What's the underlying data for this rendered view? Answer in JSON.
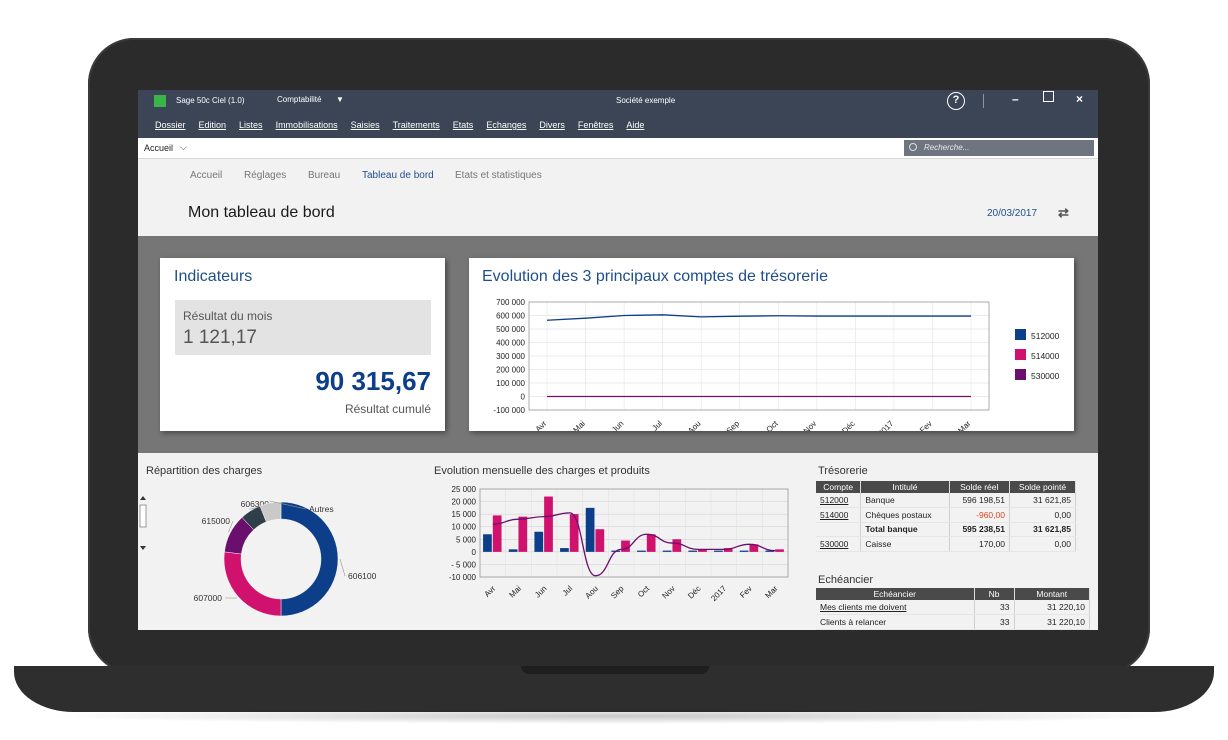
{
  "window": {
    "app_name": "Sage 50c Ciel (1.0)",
    "module": "Comptabilité",
    "company": "Société exemple",
    "help_glyph": "?",
    "minimize_glyph": "–",
    "close_glyph": "×"
  },
  "menu": [
    "Dossier",
    "Edition",
    "Listes",
    "Immobilisations",
    "Saisies",
    "Traitements",
    "Etats",
    "Echanges",
    "Divers",
    "Fenêtres",
    "Aide"
  ],
  "address": {
    "location": "Accueil",
    "search_placeholder": "Recherche..."
  },
  "tabs": [
    "Accueil",
    "Réglages",
    "Bureau",
    "Tableau de bord",
    "Etats et statistiques"
  ],
  "active_tab": "Tableau de bord",
  "page": {
    "title": "Mon tableau de bord",
    "date": "20/03/2017"
  },
  "indicateurs": {
    "title": "Indicateurs",
    "month_label": "Résultat du mois",
    "month_value": "1 121,17",
    "cumul_value": "90 315,67",
    "cumul_label": "Résultat cumulé"
  },
  "colors": {
    "accent": "#1f4e8c",
    "series_512000": "#0d3e8a",
    "series_514000": "#d0116e",
    "series_530000": "#6a0f6e",
    "negative": "#e0451b"
  },
  "icons": {
    "search": "search-icon",
    "refresh": "refresh-icon",
    "help": "help-icon",
    "dropdown": "chevron-down-icon"
  },
  "chart_data": [
    {
      "type": "line",
      "title": "Evolution des 3 principaux comptes de trésorerie",
      "categories": [
        "Avr",
        "Mai",
        "Jun",
        "Jul",
        "Aou",
        "Sep",
        "Oct",
        "Nov",
        "Déc",
        "2017",
        "Fev",
        "Mar"
      ],
      "ylim": [
        -100000,
        700000
      ],
      "yticks": [
        "700 000",
        "600 000",
        "500 000",
        "400 000",
        "300 000",
        "200 000",
        "100 000",
        "0",
        "-100 000"
      ],
      "grid": true,
      "legend": "right",
      "series": [
        {
          "name": "512000",
          "values": [
            565000,
            580000,
            600000,
            605000,
            590000,
            595000,
            598000,
            596000,
            596000,
            596000,
            596000,
            596000
          ]
        },
        {
          "name": "514000",
          "values": [
            -1000,
            -1000,
            -1000,
            -1000,
            -1000,
            -1000,
            -1000,
            -1000,
            -1000,
            -1000,
            -1000,
            -1000
          ]
        },
        {
          "name": "530000",
          "values": [
            170,
            170,
            170,
            170,
            170,
            170,
            170,
            170,
            170,
            170,
            170,
            170
          ]
        }
      ]
    },
    {
      "type": "pie",
      "title": "Répartition des charges",
      "labels": [
        "606100",
        "607000",
        "615000",
        "606300",
        "Autres"
      ],
      "values": [
        50,
        27,
        11,
        6,
        6
      ]
    },
    {
      "type": "bar",
      "title": "Evolution mensuelle des charges et produits",
      "categories": [
        "Avr",
        "Mai",
        "Jun",
        "Jul",
        "Aou",
        "Sep",
        "Oct",
        "Nov",
        "Déc",
        "2017",
        "Fev",
        "Mar"
      ],
      "ylim": [
        -10000,
        25000
      ],
      "yticks": [
        "25 000",
        "20 000",
        "15 000",
        "10 000",
        "5 000",
        "0",
        "- 5 000",
        "-10 000"
      ],
      "grid": true,
      "series": [
        {
          "name": "",
          "values": [
            7000,
            1000,
            8000,
            1500,
            17500,
            500,
            500,
            500,
            500,
            500,
            500,
            500
          ]
        },
        {
          "name": "",
          "values": [
            14500,
            14000,
            22000,
            15000,
            9000,
            4500,
            7000,
            5000,
            1000,
            1500,
            3000,
            1000
          ]
        },
        {
          "name": "",
          "values": [
            11000,
            13000,
            14000,
            15500,
            -9500,
            1000,
            7000,
            3500,
            1000,
            1000,
            3000,
            500
          ]
        }
      ]
    }
  ],
  "tresorerie": {
    "title": "Trésorerie",
    "headers": [
      "Compte",
      "Intitulé",
      "Solde réel",
      "Solde pointé"
    ],
    "rows": [
      {
        "compte": "512000",
        "intitule": "Banque",
        "reel": "596 198,51",
        "pointe": "31 621,85"
      },
      {
        "compte": "514000",
        "intitule": "Chèques postaux",
        "reel": "-960,00",
        "pointe": "0,00"
      },
      {
        "compte": "",
        "intitule": "Total banque",
        "reel": "595 238,51",
        "pointe": "31 621,85"
      },
      {
        "compte": "530000",
        "intitule": "Caisse",
        "reel": "170,00",
        "pointe": "0,00"
      }
    ]
  },
  "echeancier": {
    "title": "Echéancier",
    "headers": [
      "Echéancier",
      "Nb",
      "Montant"
    ],
    "rows": [
      {
        "label": "Mes clients me doivent",
        "nb": "33",
        "montant": "31 220,10"
      },
      {
        "label": "Clients à relancer",
        "nb": "33",
        "montant": "31 220,10"
      }
    ]
  }
}
